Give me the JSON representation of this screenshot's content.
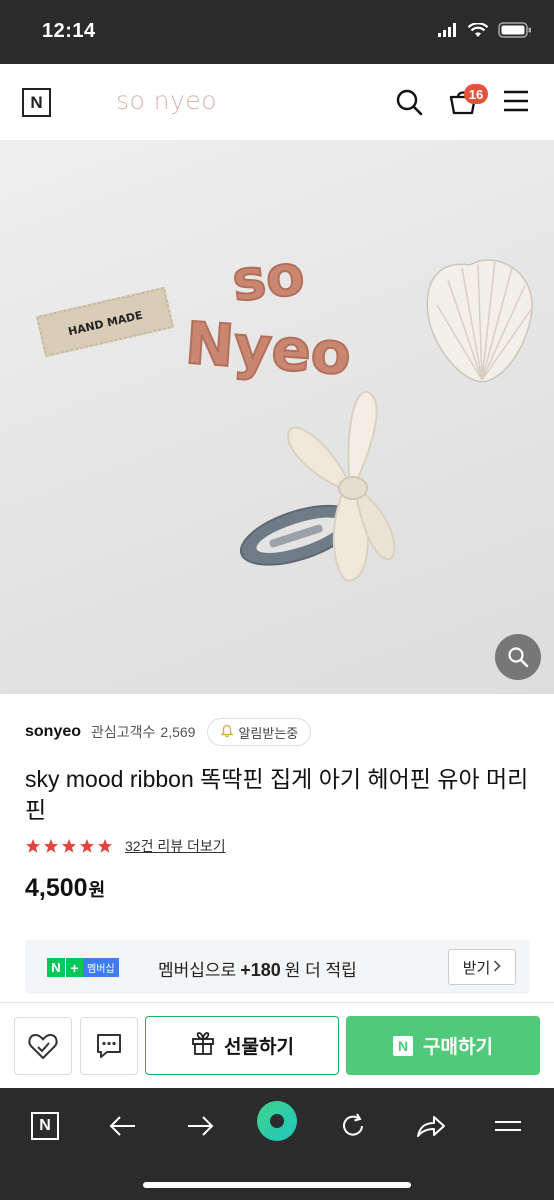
{
  "status_bar": {
    "time": "12:14"
  },
  "header": {
    "logo_letter": "N",
    "store_name": "so nyeo",
    "cart_count": "16"
  },
  "product_image": {
    "alt_text": "HAND MADE",
    "brand_piece": "so Nyeo"
  },
  "seller": {
    "name": "sonyeo",
    "followers_label": "관심고객수",
    "followers_count": "2,569",
    "notify_label": "알림받는중"
  },
  "product": {
    "title": "sky mood ribbon 똑딱핀 집게 아기 헤어핀 유아 머리핀",
    "rating_stars": 5,
    "review_link": "32건 리뷰 더보기",
    "price": "4,500",
    "currency": "원"
  },
  "membership": {
    "badge_n": "N",
    "badge_plus": "+",
    "badge_label": "멤버십",
    "text_before": "멤버십으로",
    "points": "+180",
    "text_after": "원 더 적립",
    "receive_label": "받기"
  },
  "actions": {
    "gift_label": "선물하기",
    "buy_label": "구매하기",
    "buy_badge": "N"
  },
  "browser": {
    "logo_letter": "N"
  },
  "colors": {
    "accent_green": "#51c97b",
    "gift_border": "#18b55a",
    "badge_red": "#e0543c",
    "star_red": "#e0443c",
    "store_name_color": "#d6b6a8"
  }
}
